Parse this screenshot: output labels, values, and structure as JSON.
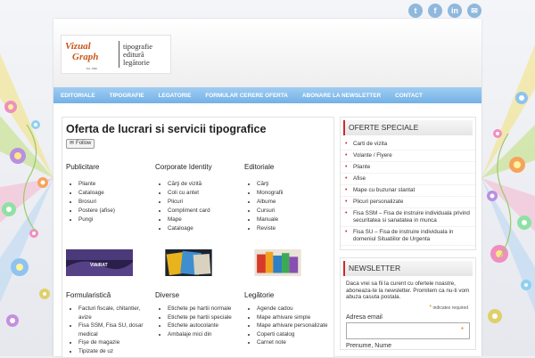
{
  "social": [
    {
      "name": "twitter",
      "glyph": "t"
    },
    {
      "name": "facebook",
      "glyph": "f"
    },
    {
      "name": "linkedin",
      "glyph": "in"
    },
    {
      "name": "email",
      "glyph": "✉"
    }
  ],
  "logo": {
    "mark_line1": "Vizual",
    "mark_line2": "Graph",
    "mark_sub": "Est. 1998",
    "text_lines": [
      "tipografie",
      "editură",
      "legătorie"
    ]
  },
  "nav": {
    "items": [
      "EDITORIALE",
      "TIPOGRAFIE",
      "LEGATORIE",
      "FORMULAR CERERE OFERTA",
      "ABONARE LA NEWSLETTER",
      "CONTACT"
    ]
  },
  "main": {
    "title": "Oferta de lucrari si servicii tipografice",
    "follow_label": "Follow",
    "columns_top": [
      {
        "heading": "Publicitare",
        "items": [
          "Pliante",
          "Cataloage",
          "Brosuri",
          "Postere (afise)",
          "Pungi"
        ]
      },
      {
        "heading": "Corporate Identity",
        "items": [
          "Cărţi de vizită",
          "Coli cu antet",
          "Plicuri",
          "Compliment card",
          "Mape",
          "Cataloage"
        ]
      },
      {
        "heading": "Editoriale",
        "items": [
          "Cărţi",
          "Monografii",
          "Albume",
          "Cursuri",
          "Manuale",
          "Reviste"
        ]
      }
    ],
    "thumb_text": "VIAIRAT",
    "columns_bottom": [
      {
        "heading": "Formularistică",
        "items": [
          "Facturi fiscale, chitantier, avize",
          "Fisa SSM, Fisa SU, dosar medical",
          "Fişe de magazie",
          "Tipizate de uz"
        ]
      },
      {
        "heading": "Diverse",
        "items": [
          "Etichete pe hartii normale",
          "Etichete pe hartii speciale",
          "Etichete autocolante",
          "Ambalaje mici din"
        ]
      },
      {
        "heading": "Legătorie",
        "items": [
          "Agende cadou",
          "Mape arhivare simple",
          "Mape arhivare personalizate",
          "Coperti catalog",
          "Carnet note"
        ]
      }
    ]
  },
  "sidebar": {
    "offers_title": "OFERTE SPECIALE",
    "offers": [
      "Carti de vizita",
      "Volante / Flyere",
      "Pliante",
      "Afise",
      "Mape cu buzunar stantat",
      "Plicuri personalizate",
      "Fisa SSM – Fisa de instruire individuala privind securitatea si sanatatea in munca",
      "Fisa SU – Fisa de instruire individuala in domeniul Situatiilor de Urgenta"
    ],
    "newsletter_title": "NEWSLETTER",
    "newsletter_text": "Daca vrei sa fii la curent cu ofertele noastre, aboneaza-te la newsletter. Promitem ca nu-ti vom abuza casuta postala.",
    "required_note": "indicates required",
    "email_label": "Adresa email",
    "name_label": "Prenume, Nume"
  },
  "colors": {
    "nav_top": "#9fcdf3",
    "nav_bottom": "#73b1e6",
    "accent_red": "#cc2a2a",
    "logo_orange": "#c8551a",
    "social_blue": "#8fb8dc"
  }
}
